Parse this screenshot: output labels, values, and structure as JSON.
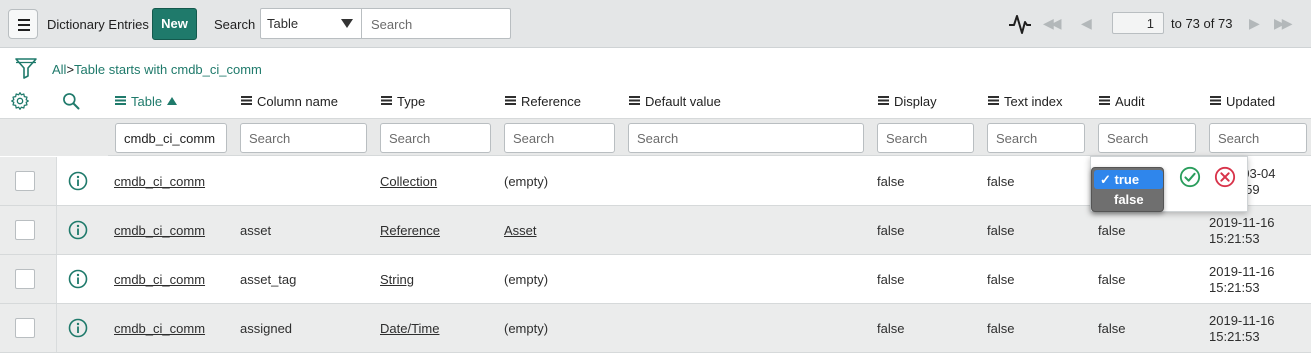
{
  "header": {
    "title": "Dictionary Entries",
    "new_label": "New",
    "search_label": "Search",
    "search_field": "Table",
    "search_placeholder": "Search",
    "page_current": "1",
    "page_range": "to 73 of 73"
  },
  "breadcrumb": {
    "all": "All",
    "separator": ">",
    "condition": "Table starts with cmdb_ci_comm"
  },
  "columns": [
    "Table",
    "Column name",
    "Type",
    "Reference",
    "Default value",
    "Display",
    "Text index",
    "Audit",
    "Updated"
  ],
  "filters": {
    "table": "cmdb_ci_comm",
    "placeholder": "Search"
  },
  "rows": [
    {
      "table": "cmdb_ci_comm",
      "column": "",
      "type": "Collection",
      "reference": "(empty)",
      "default": "",
      "display": "false",
      "text_index": "false",
      "audit": "",
      "updated_1": "2019-03-04",
      "updated_2": "15:21:59"
    },
    {
      "table": "cmdb_ci_comm",
      "column": "asset",
      "type": "Reference",
      "reference": "Asset",
      "default": "",
      "display": "false",
      "text_index": "false",
      "audit": "false",
      "updated_1": "2019-11-16",
      "updated_2": "15:21:53"
    },
    {
      "table": "cmdb_ci_comm",
      "column": "asset_tag",
      "type": "String",
      "reference": "(empty)",
      "default": "",
      "display": "false",
      "text_index": "false",
      "audit": "false",
      "updated_1": "2019-11-16",
      "updated_2": "15:21:53"
    },
    {
      "table": "cmdb_ci_comm",
      "column": "assigned",
      "type": "Date/Time",
      "reference": "(empty)",
      "default": "",
      "display": "false",
      "text_index": "false",
      "audit": "false",
      "updated_1": "2019-11-16",
      "updated_2": "15:21:53"
    }
  ],
  "inline_edit": {
    "selected_option": "✓ true",
    "other_option": "false"
  },
  "colors": {
    "accent": "#1f7a6b",
    "selected": "#2f86ec",
    "ok": "#2a9d5c",
    "cancel": "#d8334a"
  },
  "icons": [
    "menu-icon",
    "activity-icon",
    "first-page-icon",
    "prev-page-icon",
    "next-page-icon",
    "last-page-icon",
    "filter-icon",
    "gear-icon",
    "search-icon",
    "info-icon",
    "check-circle-icon",
    "cancel-circle-icon"
  ]
}
